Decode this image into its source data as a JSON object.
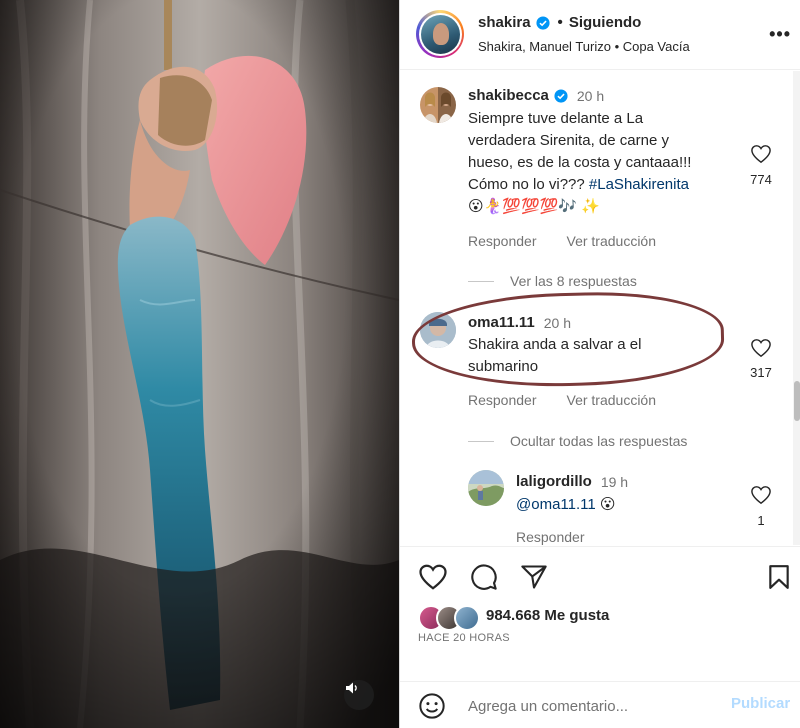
{
  "media": {
    "mute_icon": "speaker-icon"
  },
  "header": {
    "username": "shakira",
    "follow_status": "Siguiendo",
    "separator": "•",
    "audio": "Shakira, Manuel Turizo • Copa Vacía",
    "more": "•••"
  },
  "comments": [
    {
      "username": "shakibecca",
      "time": "20 h",
      "lines": [
        "Siempre tuve delante a La",
        "verdadera Sirenita, de carne y",
        "hueso, es de la costa y cantaaa!!!",
        "Cómo no lo vi???"
      ],
      "hashtag": "#LaShakirenita",
      "emojis": "😮🧜‍♀️💯💯💯🎶 ✨",
      "likes": "774",
      "reply": "Responder",
      "translate": "Ver traducción",
      "thread": "Ver las 8 respuestas"
    },
    {
      "username": "oma11.11",
      "time": "20 h",
      "lines": [
        "Shakira anda a salvar a el",
        "submarino"
      ],
      "likes": "317",
      "reply": "Responder",
      "translate": "Ver traducción",
      "thread": "Ocultar todas las respuestas"
    },
    {
      "username": "laligordillo",
      "time": "19 h",
      "mention": "@oma11.11",
      "emoji": "😮",
      "likes": "1",
      "reply": "Responder"
    }
  ],
  "post": {
    "likes": "984.668 Me gusta",
    "posted_ago": "HACE 20 HORAS",
    "comment_placeholder": "Agrega un comentario...",
    "publish": "Publicar"
  },
  "colors": {
    "verified": "#0095f6",
    "annotation": "#7a3a3a",
    "publish_disabled": "#b3dbff",
    "link": "#00376b"
  }
}
